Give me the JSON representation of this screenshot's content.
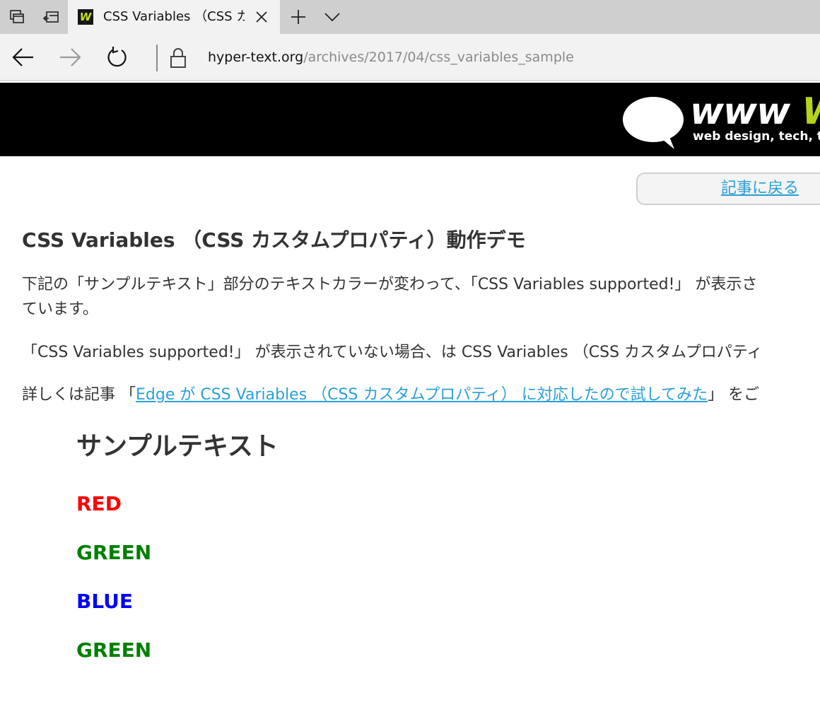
{
  "browser": {
    "tab": {
      "favicon_letter": "W",
      "title": "CSS Variables （CSS カス"
    },
    "address": {
      "host": "hyper-text.org",
      "path": "/archives/2017/04/css_variables_sample"
    },
    "icons": {
      "set_aside_tabs": "tabs-aside-icon",
      "show_aside_tabs": "tabs-restore-icon",
      "close_tab": "close-icon",
      "new_tab": "plus-icon",
      "tab_list": "chevron-down-icon",
      "back": "back-arrow-icon",
      "forward": "forward-arrow-icon",
      "refresh": "refresh-icon",
      "lock": "lock-icon"
    }
  },
  "site": {
    "logo_text_white": "www ",
    "logo_text_green": "W",
    "tagline": "web design, tech, top"
  },
  "page": {
    "back_link": "記事に戻る",
    "title": "CSS Variables （CSS カスタムプロパティ）動作デモ",
    "para1_line1": "下記の「サンプルテキスト」部分のテキストカラーが変わって、「CSS Variables supported!」 が表示さ",
    "para1_line2": "ています。",
    "para2": "「CSS Variables supported!」 が表示されていない場合、は CSS Variables （CSS カスタムプロパティ",
    "para3_prefix": "詳しくは記事 「",
    "para3_link": "Edge が CSS Variables （CSS カスタムプロパティ） に対応したので試してみた",
    "para3_suffix": "」 をご",
    "sample_heading": "サンプルテキスト",
    "colors": [
      {
        "label": "RED",
        "color": "#ff0000"
      },
      {
        "label": "GREEN",
        "color": "#008000"
      },
      {
        "label": "BLUE",
        "color": "#0000ff"
      },
      {
        "label": "GREEN",
        "color": "#008000"
      }
    ]
  },
  "theme": {
    "link_color": "#2a9fd6",
    "header_bg": "#000000",
    "logo_accent": "#b4d41c"
  }
}
